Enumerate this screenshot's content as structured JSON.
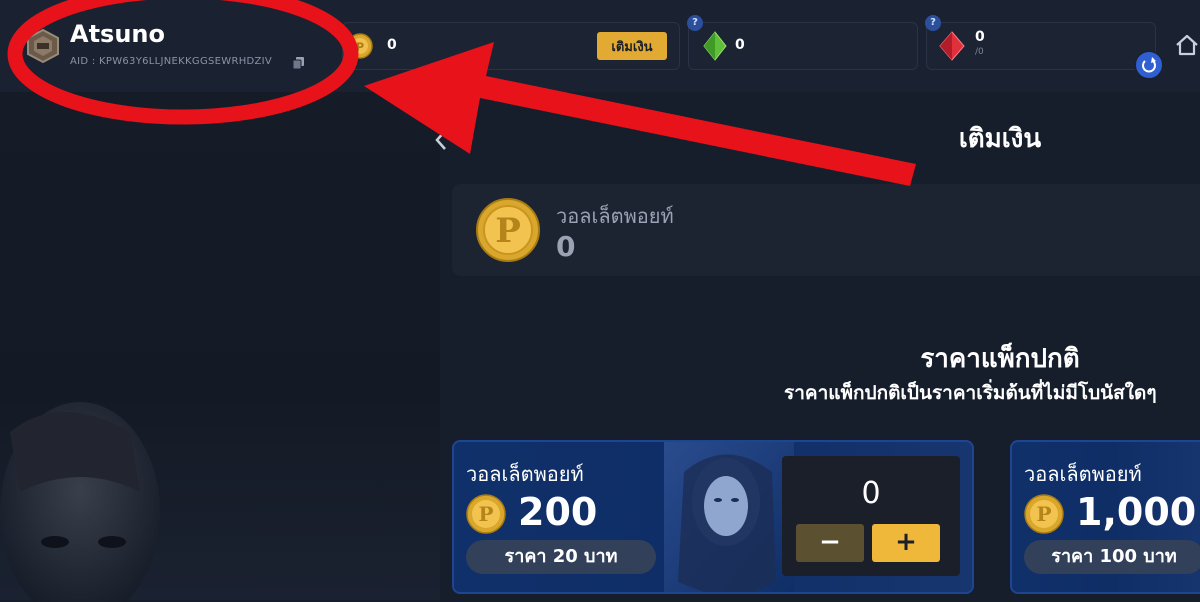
{
  "profile": {
    "username": "Atsuno",
    "aid": "AID : KPW63Y6LLJNEKKGGSEWRHDZIV"
  },
  "currencies": {
    "points": {
      "value": "0",
      "topup_label": "เติมเงิน"
    },
    "green_gem": {
      "value": "0",
      "help": "?"
    },
    "red_gem": {
      "value": "0",
      "sub": "/0",
      "help": "?"
    }
  },
  "page": {
    "title": "เติมเงิน",
    "wallet_label": "วอลเล็ตพอยท์",
    "wallet_value": "0"
  },
  "section": {
    "title": "ราคาแพ็กปกติ",
    "subtitle": "ราคาแพ็กปกติเป็นราคาเริ่มต้นที่ไม่มีโบนัสใดๆ"
  },
  "packs": [
    {
      "label": "วอลเล็ตพอยท์",
      "amount": "200",
      "price": "ราคา 20 บาท",
      "quantity": "0",
      "minus": "−",
      "plus": "+"
    },
    {
      "label": "วอลเล็ตพอยท์",
      "amount": "1,000",
      "price": "ราคา 100 บาท"
    }
  ],
  "colors": {
    "background": "#161d2b",
    "accent_gold": "#e2aa32",
    "card_blue": "#10306b",
    "annotation_red": "#e8121b"
  },
  "icons": [
    "rank-badge-icon",
    "copy-icon",
    "gold-coin-icon",
    "green-gem-icon",
    "red-gem-icon",
    "refresh-icon",
    "home-icon"
  ]
}
